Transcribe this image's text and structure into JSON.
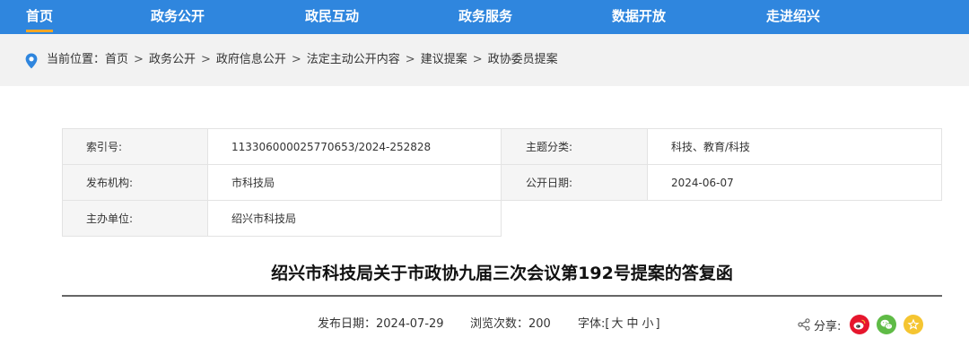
{
  "nav": {
    "items": [
      {
        "label": "首页",
        "active": true
      },
      {
        "label": "政务公开"
      },
      {
        "label": "政民互动"
      },
      {
        "label": "政务服务"
      },
      {
        "label": "数据开放"
      },
      {
        "label": "走进绍兴"
      }
    ],
    "accent_color": "#2f86de",
    "active_underline_color": "#f5a623"
  },
  "breadcrumb": {
    "prefix": "当前位置：",
    "items": [
      "首页",
      "政务公开",
      "政府信息公开",
      "法定主动公开内容",
      "建议提案",
      "政协委员提案"
    ],
    "separator": ">"
  },
  "info": {
    "index_label": "索引号:",
    "index_value": "113306000025770653/2024-252828",
    "topic_label": "主题分类:",
    "topic_value": "科技、教育/科技",
    "publisher_label": "发布机构:",
    "publisher_value": "市科技局",
    "open_date_label": "公开日期:",
    "open_date_value": "2024-06-07",
    "host_label": "主办单位:",
    "host_value": "绍兴市科技局"
  },
  "document": {
    "title": "绍兴市科技局关于市政协九届三次会议第192号提案的答复函"
  },
  "meta": {
    "publish_date_label": "发布日期：",
    "publish_date_value": "2024-07-29",
    "views_label": "浏览次数：",
    "views_value": "200",
    "font_label": "字体:[",
    "font_large": "大",
    "font_medium": "中",
    "font_small": "小",
    "font_close": "]"
  },
  "share": {
    "label": "分享:",
    "targets": [
      "weibo-icon",
      "wechat-icon",
      "qzone-icon"
    ]
  }
}
